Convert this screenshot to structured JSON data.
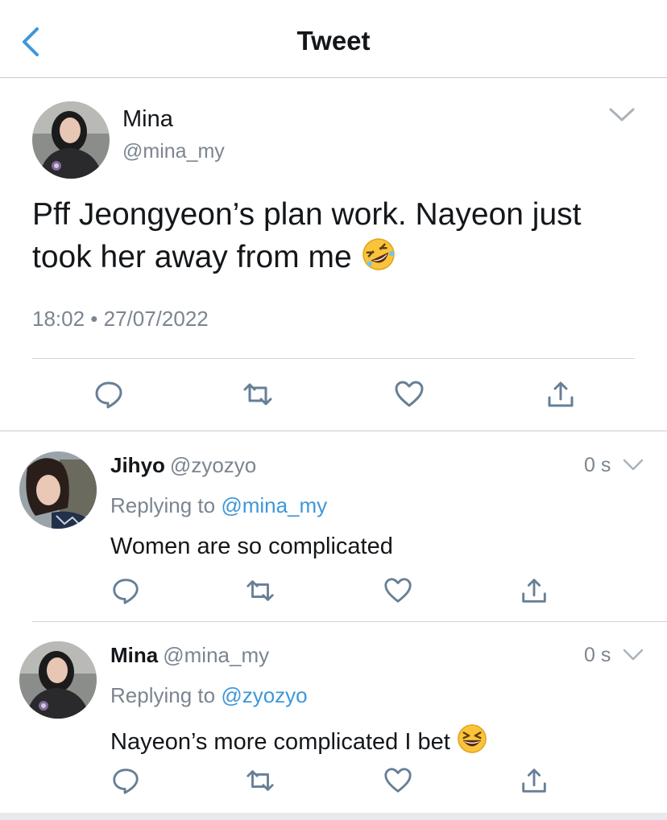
{
  "nav": {
    "title": "Tweet",
    "back_icon": "chevron-left-icon"
  },
  "main_tweet": {
    "name": "Mina",
    "handle": "@mina_my",
    "text": "Pff Jeongyeon’s plan work. Nayeon just took her away from me",
    "emoji": "rolling-on-floor-laughing-emoji",
    "timestamp": "18:02 • 27/07/2022",
    "actions": [
      "reply-icon",
      "retweet-icon",
      "like-icon",
      "share-icon"
    ]
  },
  "replies": [
    {
      "name": "Jihyo",
      "handle": "@zyozyo",
      "time": "0 s",
      "replying_prefix": "Replying to ",
      "replying_to": "@mina_my",
      "text": "Women are so complicated"
    },
    {
      "name": "Mina",
      "handle": "@mina_my",
      "time": "0 s",
      "replying_prefix": "Replying to ",
      "replying_to": "@zyozyo",
      "text": "Nayeon’s more complicated I bet",
      "emoji": "grinning-squinting-face-emoji"
    }
  ],
  "colors": {
    "accent": "#3e97d9",
    "text": "#14171a",
    "muted": "#7b8590",
    "icon": "#667f95",
    "divider": "#c8ccd0"
  }
}
